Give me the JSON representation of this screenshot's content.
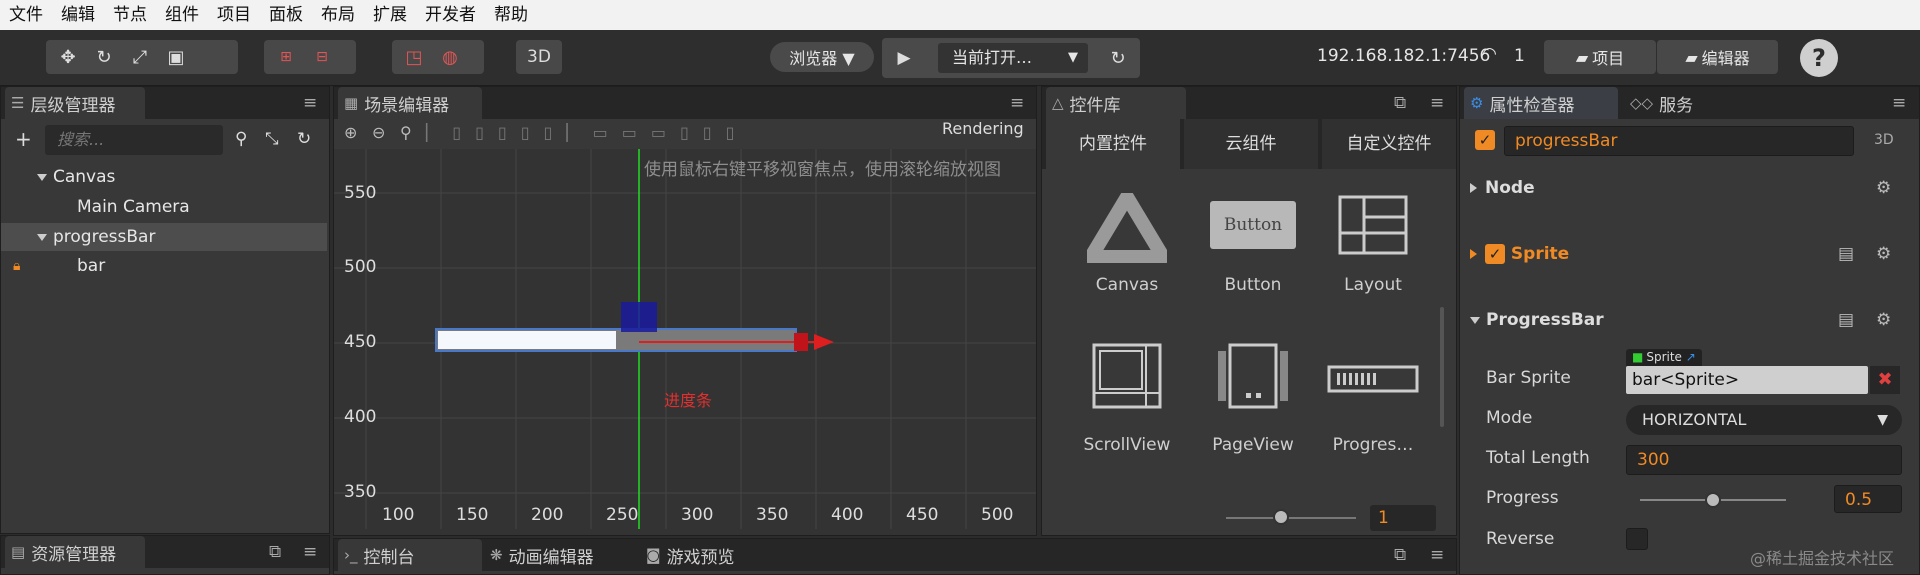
{
  "menu": [
    "文件",
    "编辑",
    "节点",
    "组件",
    "项目",
    "面板",
    "布局",
    "扩展",
    "开发者",
    "帮助"
  ],
  "toolbar": {
    "btn_3d": "3D",
    "browser_label": "浏览器 ▼",
    "scene_select": "当前打开…",
    "ip_address": "192.168.182.1:7456",
    "connections": "1",
    "project_button": "项目",
    "editor_button": "编辑器",
    "help_icon": "?"
  },
  "hierarchy": {
    "title": "层级管理器",
    "search_placeholder": "搜索...",
    "nodes": [
      "Canvas",
      "Main Camera",
      "progressBar",
      "bar"
    ]
  },
  "assets": {
    "title": "资源管理器"
  },
  "scene": {
    "title": "场景编辑器",
    "rendering_label": "Rendering",
    "hint": "使用鼠标右键平移视窗焦点，使用滚轮缩放视图",
    "y_labels": [
      "550",
      "500",
      "450",
      "400",
      "350"
    ],
    "x_labels": [
      "100",
      "150",
      "200",
      "250",
      "300",
      "350",
      "400",
      "450",
      "500"
    ],
    "node_label": "进度条",
    "progress": 0.5
  },
  "bottom_tabs": {
    "console": "控制台",
    "animation": "动画编辑器",
    "preview": "游戏预览"
  },
  "widgets": {
    "title": "控件库",
    "tabs": [
      "内置控件",
      "云组件",
      "自定义控件"
    ],
    "items": [
      "Canvas",
      "Button",
      "Layout",
      "ScrollView",
      "PageView",
      "Progres…"
    ],
    "button_preview_text": "Button",
    "zoom_value": "1"
  },
  "inspector": {
    "tab_inspector": "属性检查器",
    "tab_service": "服务",
    "node_name": "progressBar",
    "badge_3d": "3D",
    "section_node": "Node",
    "section_sprite": "Sprite",
    "section_progress": "ProgressBar",
    "asset_tag": "Sprite",
    "props": {
      "bar_sprite_label": "Bar Sprite",
      "bar_sprite_value": "bar<Sprite>",
      "mode_label": "Mode",
      "mode_value": "HORIZONTAL",
      "total_length_label": "Total Length",
      "total_length_value": "300",
      "progress_label": "Progress",
      "progress_value": "0.5",
      "progress_slider": 0.5,
      "reverse_label": "Reverse"
    }
  },
  "watermark": "@稀土掘金技术社区",
  "colors": {
    "accent": "#f08a24",
    "selection": "#4d4d4d",
    "axis_green": "#22dd22",
    "axis_red": "#dd1f1f",
    "inspector_tab": "#2b6ea8"
  }
}
